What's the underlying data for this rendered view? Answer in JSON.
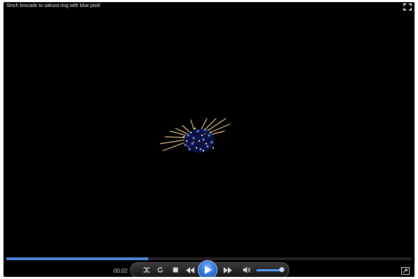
{
  "window": {
    "title": "Sinch brocade to sakura ring with blue pistil"
  },
  "playback": {
    "current_time": "00:02",
    "progress": 0.35,
    "volume": 0.95
  },
  "icons": {
    "fullscreen": "fullscreen-icon",
    "shuffle": "shuffle-icon",
    "repeat": "repeat-icon",
    "stop": "stop-icon",
    "previous": "previous-icon",
    "play": "play-icon",
    "next": "next-icon",
    "volume": "volume-icon",
    "switch_to_library": "switch-view-icon"
  },
  "colors": {
    "accent": "#4a86d9",
    "background": "#000000"
  }
}
